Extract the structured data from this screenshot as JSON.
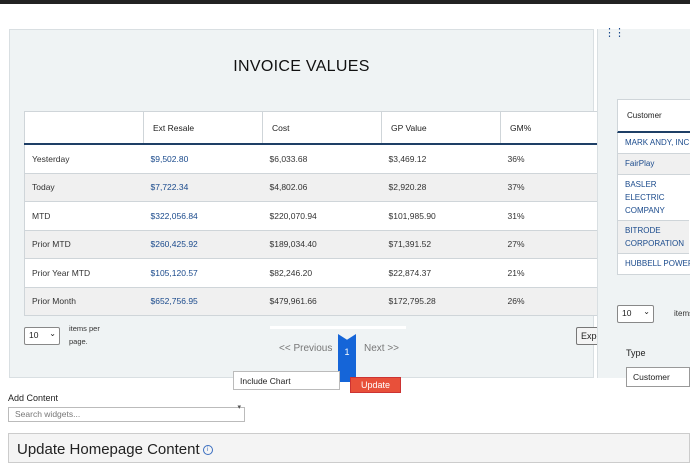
{
  "panel": {
    "title": "INVOICE VALUES",
    "columns": [
      "",
      "Ext Resale",
      "Cost",
      "GP Value",
      "GM%"
    ],
    "rows": [
      {
        "label": "Yesterday",
        "ext_resale": "$9,502.80",
        "cost": "$6,033.68",
        "gp_value": "$3,469.12",
        "gm": "36%"
      },
      {
        "label": "Today",
        "ext_resale": "$7,722.34",
        "cost": "$4,802.06",
        "gp_value": "$2,920.28",
        "gm": "37%"
      },
      {
        "label": "MTD",
        "ext_resale": "$322,056.84",
        "cost": "$220,070.94",
        "gp_value": "$101,985.90",
        "gm": "31%"
      },
      {
        "label": "Prior MTD",
        "ext_resale": "$260,425.92",
        "cost": "$189,034.40",
        "gp_value": "$71,391.52",
        "gm": "27%"
      },
      {
        "label": "Prior Year MTD",
        "ext_resale": "$105,120.57",
        "cost": "$82,246.20",
        "gp_value": "$22,874.37",
        "gm": "21%"
      },
      {
        "label": "Prior Month",
        "ext_resale": "$652,756.95",
        "cost": "$479,961.66",
        "gp_value": "$172,795.28",
        "gm": "26%"
      }
    ],
    "page_size": "10",
    "items_per_page": "items per page.",
    "pager": {
      "previous": "<< Previous",
      "current": "1",
      "next": "Next >>"
    },
    "export_label": "Export"
  },
  "right_panel": {
    "column_header": "Customer",
    "customers": [
      "MARK ANDY, INC.",
      "FairPlay",
      "BASLER ELECTRIC COMPANY",
      "BITRODE CORPORATION",
      "HUBBELL POWER"
    ],
    "page_size": "10",
    "items_per_page": "items",
    "type_label": "Type",
    "type_value": "Customer"
  },
  "include_select": "Include Chart",
  "update_button": "Update",
  "add_content": {
    "label": "Add Content",
    "search_placeholder": "Search widgets..."
  },
  "update_homepage": {
    "title": "Update Homepage Content"
  },
  "colors": {
    "accent": "#1565d8",
    "link": "#1a4a8c",
    "header_rule": "#1e3f66",
    "update": "#e8503a"
  },
  "icons": [
    "drag-grip-icon",
    "chevron-down-icon",
    "info-icon"
  ]
}
